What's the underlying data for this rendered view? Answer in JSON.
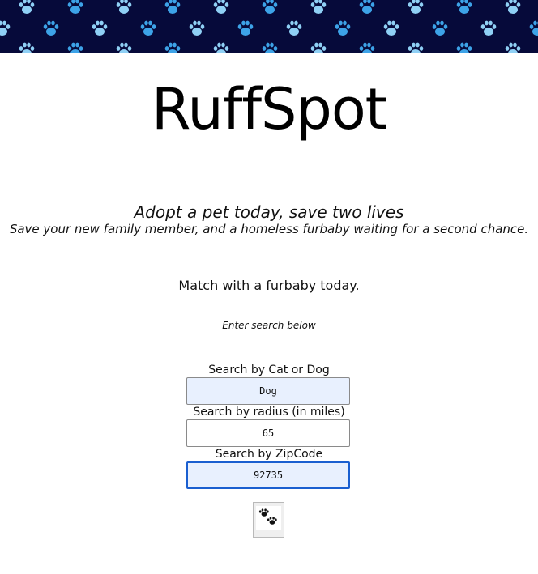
{
  "banner": {
    "background_color": "#060a3a",
    "paw_colors": [
      "#3da3e8",
      "#8fd0f5"
    ],
    "icon": "paw-print-pattern"
  },
  "header": {
    "logo_text": "RuffSpot"
  },
  "intro": {
    "tagline": "Adopt a pet today, save two lives",
    "subtagline": "Save your new family member, and a homeless furbaby waiting for a second chance.",
    "cta": "Match with a furbaby today.",
    "hint": "Enter search below"
  },
  "search": {
    "animal": {
      "label": "Search by Cat or Dog",
      "value": "Dog"
    },
    "radius": {
      "label": "Search by radius (in miles)",
      "value": "65"
    },
    "zipcode": {
      "label": "Search by ZipCode",
      "value": "92735"
    },
    "submit_icon": "paw-prints-icon"
  }
}
